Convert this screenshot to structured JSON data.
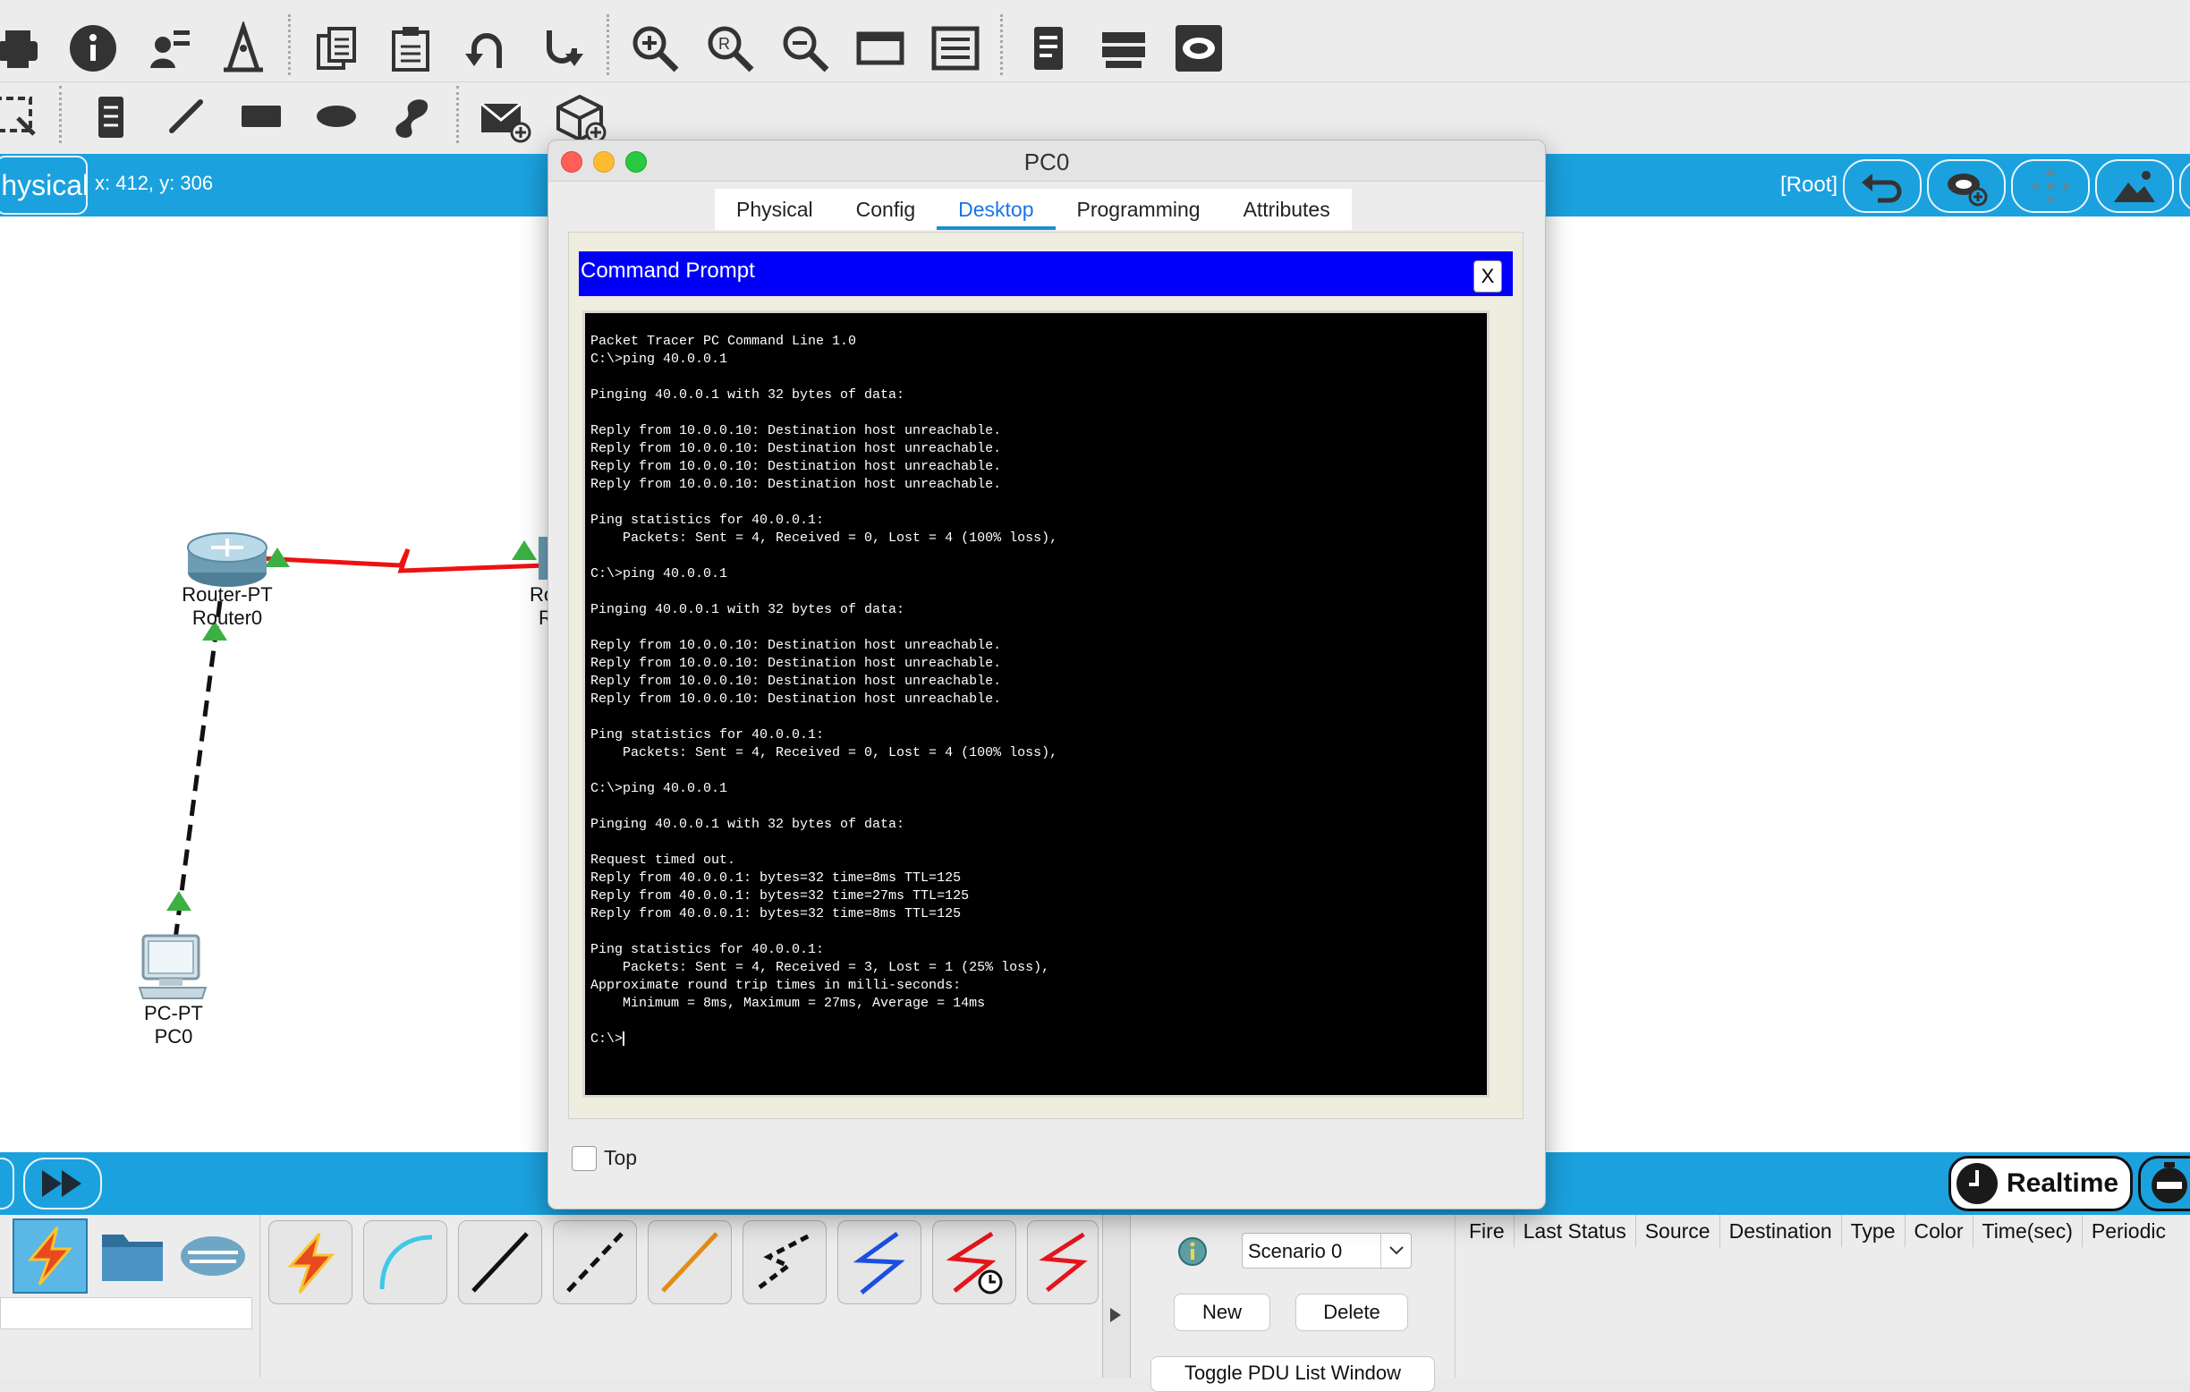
{
  "toolbar": {
    "icons_row1": [
      "print-icon",
      "info-icon",
      "user-wizard-icon",
      "activity-wizard-icon",
      "copy-icon",
      "paste-icon",
      "undo-icon",
      "redo-icon",
      "zoom-in-icon",
      "zoom-reset-icon",
      "zoom-out-icon",
      "viewport-icon",
      "drawing-palette-icon",
      "notes-icon",
      "device-list-icon",
      "cluster-icon"
    ],
    "icons_row2": [
      "select-icon",
      "note-icon",
      "line-icon",
      "rectangle-icon",
      "ellipse-icon",
      "freeform-icon",
      "add-simple-pdu-icon",
      "add-complex-pdu-icon"
    ]
  },
  "workspace": {
    "tab_label": "Physical",
    "coords": "x: 412, y: 306",
    "root_label": "[Root]"
  },
  "devices": {
    "router0": {
      "type": "Router-PT",
      "name": "Router0"
    },
    "router1": {
      "type": "Ro",
      "name": "R"
    },
    "pc0": {
      "type": "PC-PT",
      "name": "PC0"
    }
  },
  "window": {
    "title": "PC0",
    "tabs": [
      "Physical",
      "Config",
      "Desktop",
      "Programming",
      "Attributes"
    ],
    "active_tab": "Desktop",
    "panel_title": "Command Prompt",
    "close_label": "X",
    "terminal_lines": [
      "Packet Tracer PC Command Line 1.0",
      "C:\\>ping 40.0.0.1",
      "",
      "Pinging 40.0.0.1 with 32 bytes of data:",
      "",
      "Reply from 10.0.0.10: Destination host unreachable.",
      "Reply from 10.0.0.10: Destination host unreachable.",
      "Reply from 10.0.0.10: Destination host unreachable.",
      "Reply from 10.0.0.10: Destination host unreachable.",
      "",
      "Ping statistics for 40.0.0.1:",
      "    Packets: Sent = 4, Received = 0, Lost = 4 (100% loss),",
      "",
      "C:\\>ping 40.0.0.1",
      "",
      "Pinging 40.0.0.1 with 32 bytes of data:",
      "",
      "Reply from 10.0.0.10: Destination host unreachable.",
      "Reply from 10.0.0.10: Destination host unreachable.",
      "Reply from 10.0.0.10: Destination host unreachable.",
      "Reply from 10.0.0.10: Destination host unreachable.",
      "",
      "Ping statistics for 40.0.0.1:",
      "    Packets: Sent = 4, Received = 0, Lost = 4 (100% loss),",
      "",
      "C:\\>ping 40.0.0.1",
      "",
      "Pinging 40.0.0.1 with 32 bytes of data:",
      "",
      "Request timed out.",
      "Reply from 40.0.0.1: bytes=32 time=8ms TTL=125",
      "Reply from 40.0.0.1: bytes=32 time=27ms TTL=125",
      "Reply from 40.0.0.1: bytes=32 time=8ms TTL=125",
      "",
      "Ping statistics for 40.0.0.1:",
      "    Packets: Sent = 4, Received = 3, Lost = 1 (25% loss),",
      "Approximate round trip times in milli-seconds:",
      "    Minimum = 8ms, Maximum = 27ms, Average = 14ms",
      "",
      "C:\\>"
    ],
    "top_checkbox_label": "Top"
  },
  "bottom": {
    "realtime_label": "Realtime",
    "scenario": "Scenario 0",
    "new_label": "New",
    "delete_label": "Delete",
    "toggle_label": "Toggle PDU List Window",
    "pdu_columns": [
      "Fire",
      "Last Status",
      "Source",
      "Destination",
      "Type",
      "Color",
      "Time(sec)",
      "Periodic"
    ]
  },
  "colors": {
    "accent_blue": "#1ba1de",
    "cmd_header": "#0000fa",
    "serial_link": "#ee1111",
    "port_up": "#3cb043"
  }
}
